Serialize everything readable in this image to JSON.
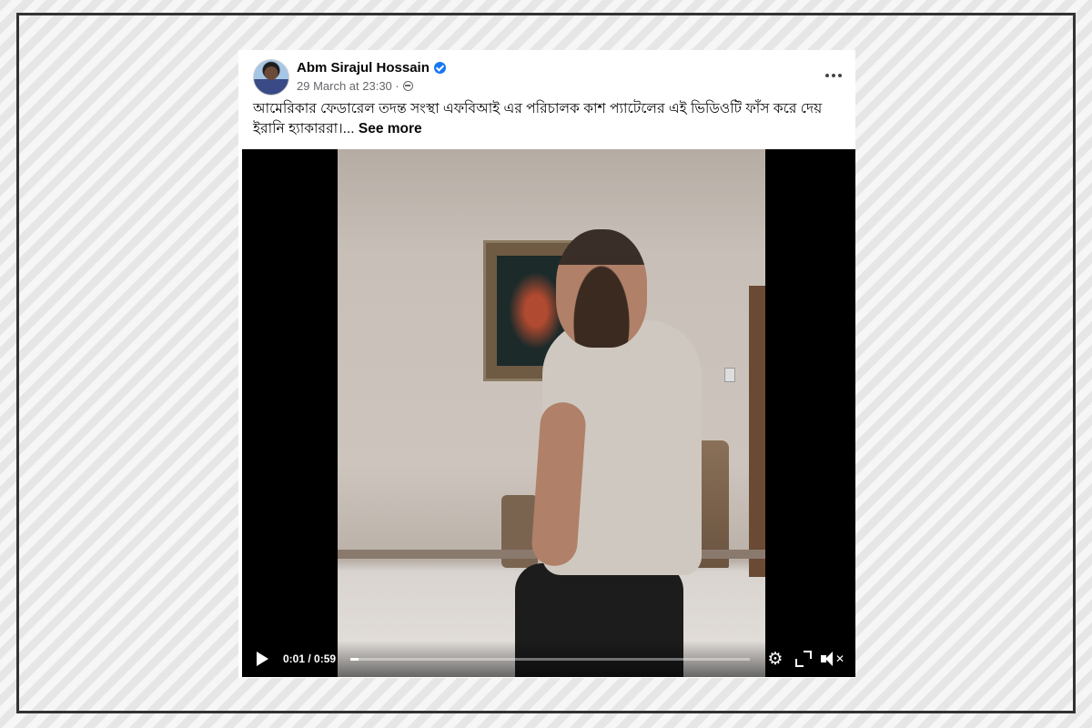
{
  "post": {
    "author": "Abm Sirajul Hossain",
    "timestamp": "29 March at 23:30 ·",
    "text": "আমেরিকার ফেডারেল তদন্ত সংস্থা এফবিআই এর পরিচালক কাশ প্যাটেলের এই ভিডিওটি ফাঁস করে দেয় ইরানি হ্যাকাররা।...",
    "see_more": "See more",
    "icons": {
      "verified": "verified-badge-icon",
      "privacy": "globe-icon",
      "menu": "more-options-icon"
    }
  },
  "video": {
    "current_time": "0:01",
    "duration": "0:59",
    "time_display": "0:01 / 0:59",
    "progress_fraction": 0.02,
    "controls": {
      "play": "play-icon",
      "settings": "settings-gear-icon",
      "fullscreen": "fullscreen-icon",
      "volume": "muted-speaker-icon"
    }
  },
  "colors": {
    "accent": "#1877f2",
    "text_primary": "#050505",
    "text_secondary": "#65676b"
  }
}
